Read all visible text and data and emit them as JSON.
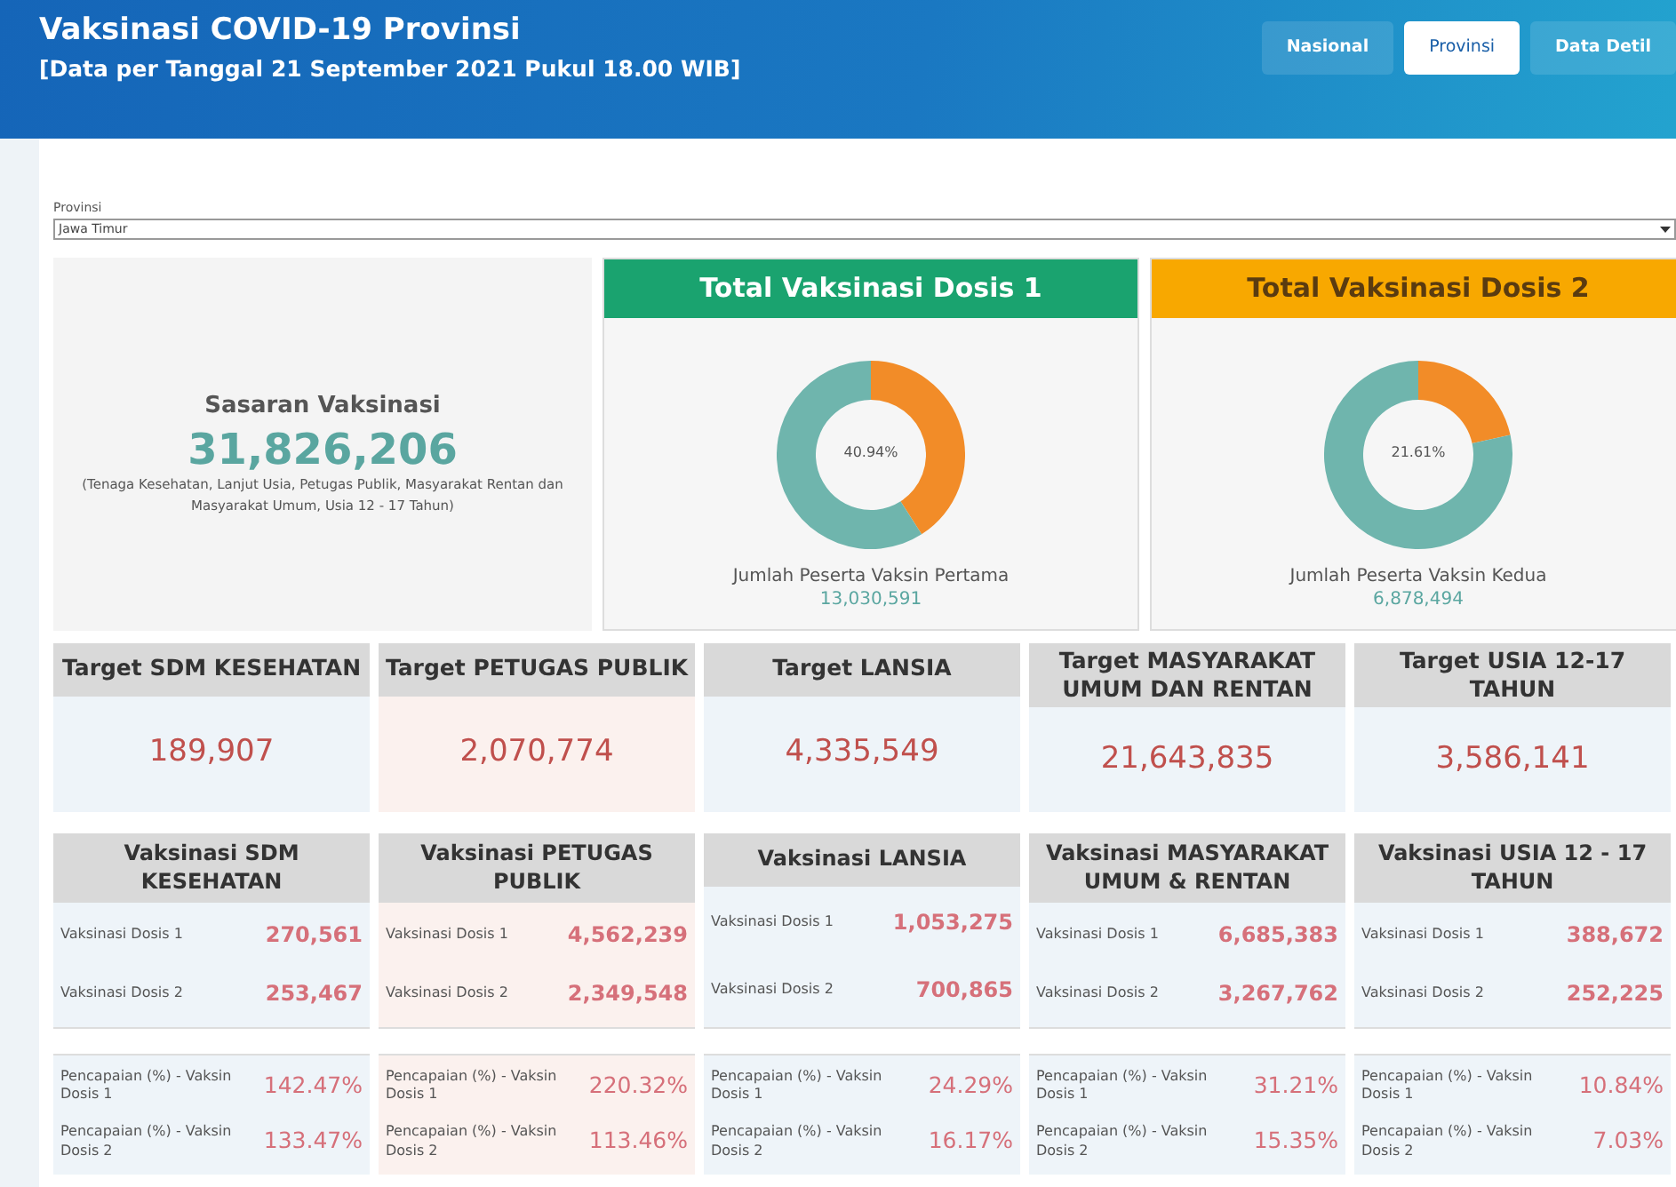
{
  "header": {
    "title": "Vaksinasi COVID-19 Provinsi",
    "subtitle": "[Data per Tanggal 21 September 2021 Pukul 18.00 WIB]",
    "tabs": [
      {
        "label": "Nasional",
        "selected": false
      },
      {
        "label": "Provinsi",
        "selected": true
      },
      {
        "label": "Data Detil",
        "selected": false
      }
    ]
  },
  "filter": {
    "label": "Provinsi",
    "value": "Jawa Timur"
  },
  "sasaran": {
    "title": "Sasaran Vaksinasi",
    "value": "31,826,206",
    "note": "(Tenaga Kesehatan, Lanjut Usia, Petugas Publik, Masyarakat Rentan dan Masyarakat Umum, Usia 12 - 17 Tahun)"
  },
  "dose_panels": [
    {
      "title": "Total Vaksinasi Dosis 1",
      "color": "#1aa36f",
      "chart_data": {
        "type": "donut",
        "values": [
          40.94,
          59.06
        ]
      },
      "center_label": "40.94%",
      "caption": "Jumlah Peserta Vaksin Pertama",
      "value": "13,030,591"
    },
    {
      "title": "Total Vaksinasi Dosis 2",
      "color": "#f8a800",
      "chart_data": {
        "type": "donut",
        "values": [
          21.61,
          78.39
        ]
      },
      "center_label": "21.61%",
      "caption": "Jumlah Peserta Vaksin Kedua",
      "value": "6,878,494"
    }
  ],
  "targets": [
    {
      "title": "Target SDM KESEHATAN",
      "value": "189,907",
      "color": "#eef4f9"
    },
    {
      "title": "Target PETUGAS PUBLIK",
      "value": "2,070,774",
      "color": "#fbf1ee"
    },
    {
      "title": "Target LANSIA",
      "value": "4,335,549",
      "color": "#eef4f9"
    },
    {
      "title": "Target MASYARAKAT UMUM DAN RENTAN",
      "value": "21,643,835",
      "color": "#eef4f9"
    },
    {
      "title": "Target USIA 12-17 TAHUN",
      "value": "3,586,141",
      "color": "#eef4f9"
    }
  ],
  "groups": [
    {
      "title": "Vaksinasi SDM KESEHATAN",
      "color": "#eef4f9",
      "doses": [
        {
          "label": "Vaksinasi Dosis 1",
          "value": "270,561"
        },
        {
          "label": "Vaksinasi Dosis 2",
          "value": "253,467"
        }
      ],
      "achievements": [
        {
          "label": "Pencapaian (%) - Vaksin Dosis 1",
          "value": "142.47%"
        },
        {
          "label": "Pencapaian (%) - Vaksin Dosis 2",
          "value": "133.47%"
        }
      ]
    },
    {
      "title": "Vaksinasi PETUGAS PUBLIK",
      "color": "#fbf1ee",
      "doses": [
        {
          "label": "Vaksinasi Dosis 1",
          "value": "4,562,239"
        },
        {
          "label": "Vaksinasi Dosis 2",
          "value": "2,349,548"
        }
      ],
      "achievements": [
        {
          "label": "Pencapaian (%) - Vaksin Dosis 1",
          "value": "220.32%"
        },
        {
          "label": "Pencapaian (%) - Vaksin Dosis 2",
          "value": "113.46%"
        }
      ]
    },
    {
      "title": "Vaksinasi LANSIA",
      "color": "#eef4f9",
      "doses": [
        {
          "label": "Vaksinasi Dosis 1",
          "value": "1,053,275"
        },
        {
          "label": "Vaksinasi Dosis 2",
          "value": "700,865"
        }
      ],
      "achievements": [
        {
          "label": "Pencapaian (%) - Vaksin Dosis 1",
          "value": "24.29%"
        },
        {
          "label": "Pencapaian (%) - Vaksin Dosis 2",
          "value": "16.17%"
        }
      ]
    },
    {
      "title": "Vaksinasi MASYARAKAT UMUM & RENTAN",
      "color": "#eef4f9",
      "doses": [
        {
          "label": "Vaksinasi Dosis 1",
          "value": "6,685,383"
        },
        {
          "label": "Vaksinasi Dosis 2",
          "value": "3,267,762"
        }
      ],
      "achievements": [
        {
          "label": "Pencapaian (%) - Vaksin Dosis 1",
          "value": "31.21%"
        },
        {
          "label": "Pencapaian (%) - Vaksin Dosis 2",
          "value": "15.35%"
        }
      ]
    },
    {
      "title": "Vaksinasi USIA 12 - 17 TAHUN",
      "color": "#eef4f9",
      "doses": [
        {
          "label": "Vaksinasi Dosis 1",
          "value": "388,672"
        },
        {
          "label": "Vaksinasi Dosis 2",
          "value": "252,225"
        }
      ],
      "achievements": [
        {
          "label": "Pencapaian (%) - Vaksin Dosis 1",
          "value": "10.84%"
        },
        {
          "label": "Pencapaian (%) - Vaksin Dosis 2",
          "value": "7.03%"
        }
      ]
    }
  ]
}
